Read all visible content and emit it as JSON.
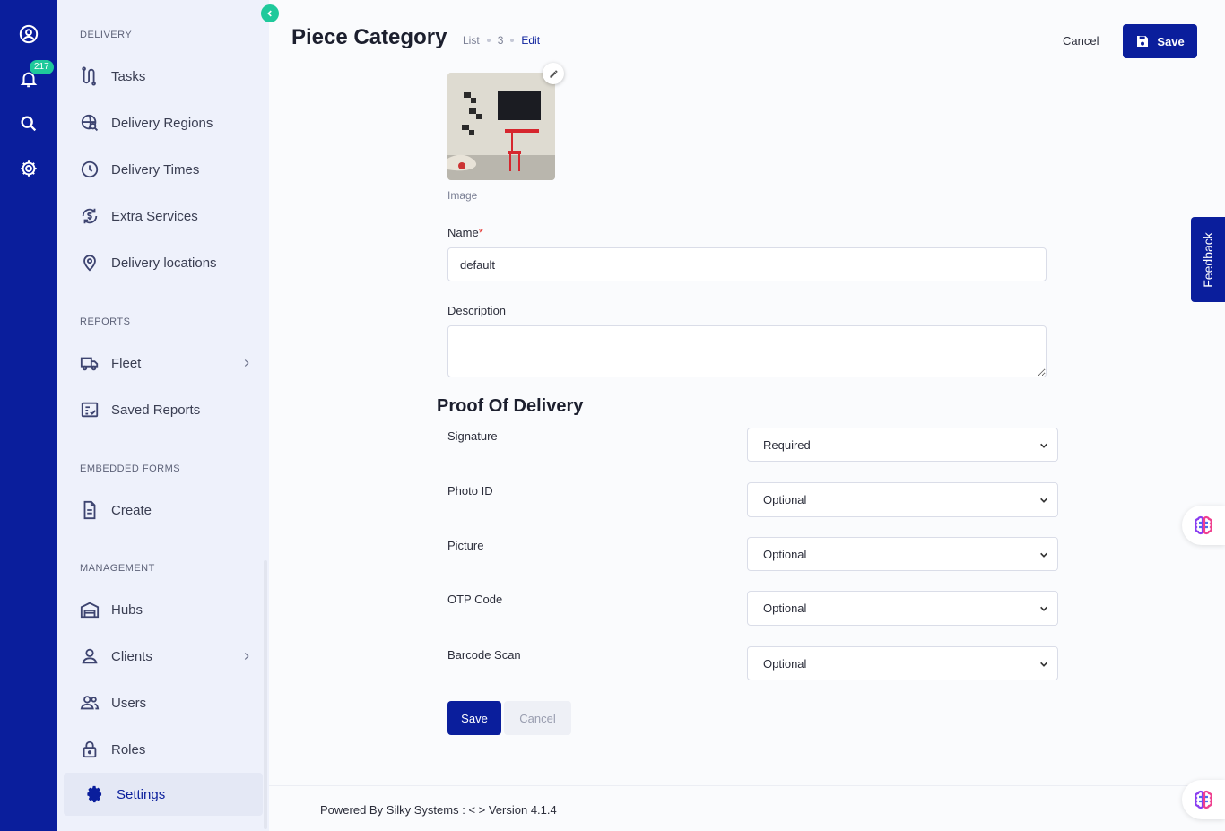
{
  "rail": {
    "notification_count": "217",
    "icons": [
      "user-circle-icon",
      "bell-icon",
      "search-icon",
      "gear-icon"
    ]
  },
  "sidebar": {
    "sections": [
      {
        "title": "DELIVERY",
        "items": [
          {
            "label": "Tasks",
            "icon": "route-icon"
          },
          {
            "label": "Delivery Regions",
            "icon": "globe-search-icon"
          },
          {
            "label": "Delivery Times",
            "icon": "clock-icon"
          },
          {
            "label": "Extra Services",
            "icon": "dollar-refresh-icon"
          },
          {
            "label": "Delivery locations",
            "icon": "map-pin-icon"
          }
        ]
      },
      {
        "title": "REPORTS",
        "items": [
          {
            "label": "Fleet",
            "icon": "truck-icon",
            "has_children": true
          },
          {
            "label": "Saved Reports",
            "icon": "report-check-icon"
          }
        ]
      },
      {
        "title": "EMBEDDED FORMS",
        "items": [
          {
            "label": "Create",
            "icon": "document-icon"
          }
        ]
      },
      {
        "title": "MANAGEMENT",
        "items": [
          {
            "label": "Hubs",
            "icon": "warehouse-icon"
          },
          {
            "label": "Clients",
            "icon": "person-icon",
            "has_children": true
          },
          {
            "label": "Users",
            "icon": "users-icon"
          },
          {
            "label": "Roles",
            "icon": "lock-icon"
          },
          {
            "label": "Settings",
            "icon": "gear-icon",
            "active": true
          }
        ]
      }
    ]
  },
  "header": {
    "title": "Piece Category",
    "breadcrumb": [
      "List",
      "3",
      "Edit"
    ],
    "cancel_label": "Cancel",
    "save_label": "Save"
  },
  "form": {
    "image_label": "Image",
    "name_label": "Name",
    "name_required_mark": "*",
    "name_value": "default",
    "description_label": "Description",
    "description_value": "",
    "pod_title": "Proof Of Delivery",
    "pod_fields": [
      {
        "label": "Signature",
        "value": "Required"
      },
      {
        "label": "Photo ID",
        "value": "Optional"
      },
      {
        "label": "Picture",
        "value": "Optional"
      },
      {
        "label": "OTP Code",
        "value": "Optional"
      },
      {
        "label": "Barcode Scan",
        "value": "Optional"
      }
    ],
    "save_label": "Save",
    "cancel_label": "Cancel"
  },
  "footer": {
    "text": "Powered By Silky Systems : < > Version 4.1.4"
  },
  "feedback_label": "Feedback",
  "colors": {
    "primary": "#0a1e9c",
    "accent": "#1fc99b",
    "sidebar_bg": "#eef1fb"
  }
}
